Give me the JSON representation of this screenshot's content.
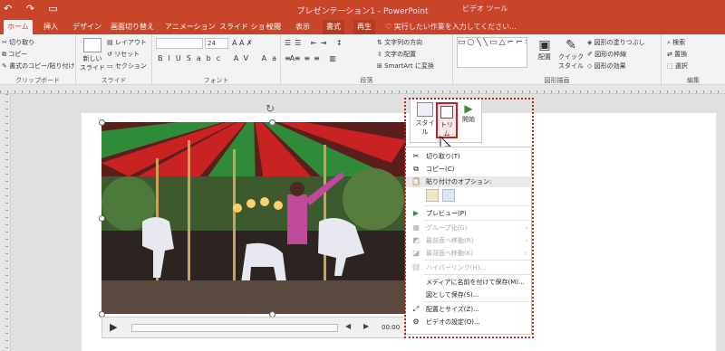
{
  "titlebar": {
    "title": "プレゼンテーション1 - PowerPoint",
    "context_group": "ビデオ ツール"
  },
  "tabs": [
    "ホーム",
    "挿入",
    "デザイン",
    "画面切り替え",
    "アニメーション",
    "スライド ショー",
    "校閲",
    "表示",
    "書式",
    "再生"
  ],
  "tell_me": "実行したい作業を入力してください...",
  "ribbon": {
    "clipboard": {
      "label": "クリップボード",
      "cut": "切り取り",
      "copy": "コピー",
      "format_painter": "書式のコピー/貼り付け"
    },
    "slides": {
      "label": "スライド",
      "new_slide": "新しい スライド",
      "layout": "レイアウト",
      "reset": "リセット",
      "section": "セクション"
    },
    "font": {
      "label": "フォント",
      "size": "24"
    },
    "paragraph": {
      "label": "段落",
      "text_direction": "文字列の方向",
      "align_text": "文字の配置",
      "smartart": "SmartArt に変換"
    },
    "drawing": {
      "label": "図形描画",
      "arrange": "配置",
      "quick_styles": "クイック スタイル",
      "shape_fill": "図形の塗りつぶし",
      "shape_outline": "図形の枠線",
      "shape_effects": "図形の効果"
    },
    "editing": {
      "label": "編集",
      "find": "検索",
      "replace": "置換",
      "select": "選択"
    }
  },
  "player": {
    "time": "00:00"
  },
  "mini_toolbar": {
    "style": "スタイル",
    "trim": "トリム",
    "start": "開始"
  },
  "context_menu": {
    "items": [
      {
        "label": "切り取り(T)",
        "icon": "scissors-icon",
        "disabled": false
      },
      {
        "label": "コピー(C)",
        "icon": "copy-icon",
        "disabled": false
      },
      {
        "label": "貼り付けのオプション:",
        "icon": "paste-icon",
        "disabled": false
      },
      {
        "label": "プレビュー(P)",
        "icon": "play-icon",
        "disabled": false
      },
      {
        "label": "グループ化(G)",
        "icon": "group-icon",
        "disabled": true
      },
      {
        "label": "最前面へ移動(R)",
        "icon": "bring-front-icon",
        "disabled": true
      },
      {
        "label": "最背面へ移動(K)",
        "icon": "send-back-icon",
        "disabled": true
      },
      {
        "label": "ハイパーリンク(H)...",
        "icon": "link-icon",
        "disabled": true
      },
      {
        "label": "メディアに名前を付けて保存(M)...",
        "icon": "",
        "disabled": false
      },
      {
        "label": "図として保存(S)...",
        "icon": "",
        "disabled": false
      },
      {
        "label": "配置とサイズ(Z)...",
        "icon": "size-icon",
        "disabled": false
      },
      {
        "label": "ビデオの設定(O)...",
        "icon": "video-settings-icon",
        "disabled": false
      }
    ]
  },
  "colors": {
    "accent": "#c9452a",
    "highlight": "#c0202a"
  }
}
